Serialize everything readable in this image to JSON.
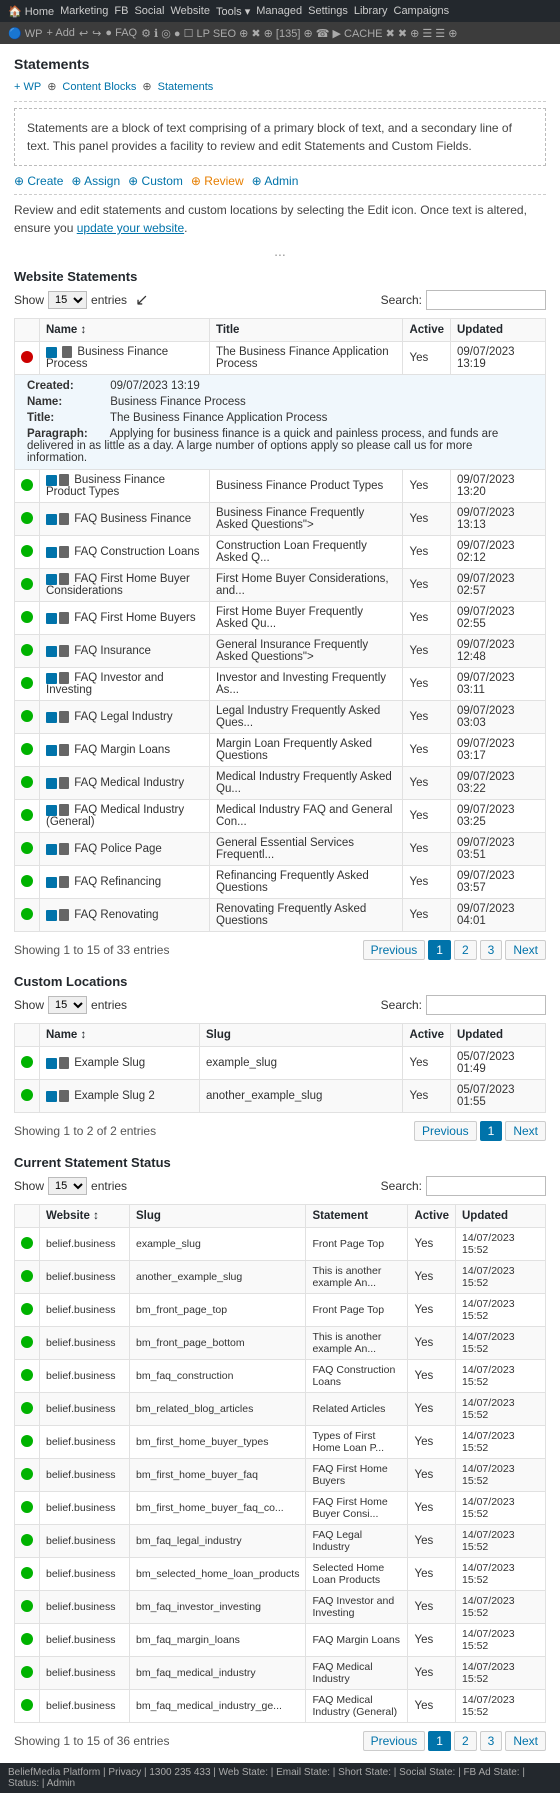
{
  "topbar": {
    "items": [
      "Home",
      "Marketing",
      "FB",
      "Social",
      "Website",
      "Tools",
      "Managed",
      "Settings",
      "Library",
      "Campaigns"
    ]
  },
  "secondbar": {
    "items": [
      "WP",
      "Add",
      "Undo",
      "Redo",
      "FAQ",
      "LP",
      "SEO",
      "135",
      "CACHE"
    ]
  },
  "statements_section": {
    "title": "Statements",
    "breadcrumbs": [
      "WP",
      "Content Blocks",
      "Statements"
    ],
    "description": "Statements are a block of text comprising of a primary block of text, and a secondary line of text. This panel provides a facility to review and edit Statements and Custom Fields.",
    "actions": [
      "Create",
      "Assign",
      "Custom",
      "Review",
      "Admin"
    ],
    "review_text": "Review and edit statements and custom locations by selecting the Edit icon. Once text is altered, ensure you",
    "review_link_text": "update your website",
    "ellipsis": "..."
  },
  "website_statements": {
    "title": "Website Statements",
    "show_label": "Show",
    "show_value": "15",
    "entries_label": "entries",
    "search_label": "Search:",
    "search_value": "",
    "columns": [
      "",
      "Name",
      "Title",
      "Active",
      "Updated"
    ],
    "expanded_row": {
      "created_label": "Created:",
      "created_value": "09/07/2023 13:19",
      "name_label": "Name:",
      "name_value": "Business Finance Process",
      "title_label": "Title:",
      "title_value": "The Business Finance Application Process",
      "paragraph_label": "Paragraph:",
      "paragraph_value": "Applying for business finance is a quick and painless process, and funds are delivered in as little as a day. A large number of options apply so please call us for more information."
    },
    "rows": [
      {
        "status": "red",
        "name": "Business Finance Process",
        "title": "The Business Finance Application Process",
        "active": "Yes",
        "updated": "09/07/2023 13:19",
        "expanded": true
      },
      {
        "status": "green",
        "name": "Business Finance Product Types",
        "title": "Business Finance Product Types",
        "active": "Yes",
        "updated": "09/07/2023 13:20"
      },
      {
        "status": "green",
        "name": "FAQ Business Finance",
        "title": "Business Finance Frequently Asked Questions\">",
        "active": "Yes",
        "updated": "09/07/2023 13:13"
      },
      {
        "status": "green",
        "name": "FAQ Construction Loans",
        "title": "Construction Loan Frequently Asked Q...",
        "active": "Yes",
        "updated": "09/07/2023 02:12"
      },
      {
        "status": "green",
        "name": "FAQ First Home Buyer Considerations",
        "title": "First Home Buyer Considerations, and...",
        "active": "Yes",
        "updated": "09/07/2023 02:57"
      },
      {
        "status": "green",
        "name": "FAQ First Home Buyers",
        "title": "First Home Buyer Frequently Asked Qu...",
        "active": "Yes",
        "updated": "09/07/2023 02:55"
      },
      {
        "status": "green",
        "name": "FAQ Insurance",
        "title": "General Insurance Frequently Asked Questions\">",
        "active": "Yes",
        "updated": "09/07/2023 12:48"
      },
      {
        "status": "green",
        "name": "FAQ Investor and Investing",
        "title": "Investor and Investing Frequently As...",
        "active": "Yes",
        "updated": "09/07/2023 03:11"
      },
      {
        "status": "green",
        "name": "FAQ Legal Industry",
        "title": "Legal Industry Frequently Asked Ques...",
        "active": "Yes",
        "updated": "09/07/2023 03:03"
      },
      {
        "status": "green",
        "name": "FAQ Margin Loans",
        "title": "Margin Loan Frequently Asked Questions",
        "active": "Yes",
        "updated": "09/07/2023 03:17"
      },
      {
        "status": "green",
        "name": "FAQ Medical Industry",
        "title": "Medical Industry Frequently Asked Qu...",
        "active": "Yes",
        "updated": "09/07/2023 03:22"
      },
      {
        "status": "green",
        "name": "FAQ Medical Industry (General)",
        "title": "Medical Industry FAQ and General Con...",
        "active": "Yes",
        "updated": "09/07/2023 03:25"
      },
      {
        "status": "green",
        "name": "FAQ Police Page",
        "title": "General Essential Services Frequentl...",
        "active": "Yes",
        "updated": "09/07/2023 03:51"
      },
      {
        "status": "green",
        "name": "FAQ Refinancing",
        "title": "Refinancing Frequently Asked Questions",
        "active": "Yes",
        "updated": "09/07/2023 03:57"
      },
      {
        "status": "green",
        "name": "FAQ Renovating",
        "title": "Renovating Frequently Asked Questions",
        "active": "Yes",
        "updated": "09/07/2023 04:01"
      }
    ],
    "showing": "Showing 1 to 15 of 33 entries",
    "pagination": {
      "prev": "Previous",
      "pages": [
        "1",
        "2",
        "3"
      ],
      "next": "Next",
      "active_page": "1"
    }
  },
  "custom_locations": {
    "title": "Custom Locations",
    "show_label": "Show",
    "show_value": "15",
    "entries_label": "entries",
    "search_label": "Search:",
    "search_value": "",
    "columns": [
      "",
      "Name",
      "Slug",
      "Active",
      "Updated"
    ],
    "rows": [
      {
        "status": "green",
        "name": "Example Slug",
        "slug": "example_slug",
        "active": "Yes",
        "updated": "05/07/2023 01:49"
      },
      {
        "status": "green",
        "name": "Example Slug 2",
        "slug": "another_example_slug",
        "active": "Yes",
        "updated": "05/07/2023 01:55"
      }
    ],
    "showing": "Showing 1 to 2 of 2 entries",
    "pagination": {
      "prev": "Previous",
      "pages": [
        "1"
      ],
      "next": "Next",
      "active_page": "1"
    }
  },
  "current_status": {
    "title": "Current Statement Status",
    "show_label": "Show",
    "show_value": "15",
    "entries_label": "entries",
    "search_label": "Search:",
    "search_value": "",
    "columns": [
      "",
      "Website",
      "Slug",
      "Statement",
      "Active",
      "Updated"
    ],
    "rows": [
      {
        "status": "green",
        "website": "belief.business",
        "slug": "example_slug",
        "statement": "Front Page Top",
        "active": "Yes",
        "updated": "14/07/2023 15:52"
      },
      {
        "status": "green",
        "website": "belief.business",
        "slug": "another_example_slug",
        "statement": "This is another example An...",
        "active": "Yes",
        "updated": "14/07/2023 15:52"
      },
      {
        "status": "green",
        "website": "belief.business",
        "slug": "bm_front_page_top",
        "statement": "Front Page Top",
        "active": "Yes",
        "updated": "14/07/2023 15:52"
      },
      {
        "status": "green",
        "website": "belief.business",
        "slug": "bm_front_page_bottom",
        "statement": "This is another example An...",
        "active": "Yes",
        "updated": "14/07/2023 15:52"
      },
      {
        "status": "green",
        "website": "belief.business",
        "slug": "bm_faq_construction",
        "statement": "FAQ Construction Loans",
        "active": "Yes",
        "updated": "14/07/2023 15:52"
      },
      {
        "status": "green",
        "website": "belief.business",
        "slug": "bm_related_blog_articles",
        "statement": "Related Articles",
        "active": "Yes",
        "updated": "14/07/2023 15:52"
      },
      {
        "status": "green",
        "website": "belief.business",
        "slug": "bm_first_home_buyer_types",
        "statement": "Types of First Home Loan P...",
        "active": "Yes",
        "updated": "14/07/2023 15:52"
      },
      {
        "status": "green",
        "website": "belief.business",
        "slug": "bm_first_home_buyer_faq",
        "statement": "FAQ First Home Buyers",
        "active": "Yes",
        "updated": "14/07/2023 15:52"
      },
      {
        "status": "green",
        "website": "belief.business",
        "slug": "bm_first_home_buyer_faq_co...",
        "statement": "FAQ First Home Buyer Consi...",
        "active": "Yes",
        "updated": "14/07/2023 15:52"
      },
      {
        "status": "green",
        "website": "belief.business",
        "slug": "bm_faq_legal_industry",
        "statement": "FAQ Legal Industry",
        "active": "Yes",
        "updated": "14/07/2023 15:52"
      },
      {
        "status": "green",
        "website": "belief.business",
        "slug": "bm_selected_home_loan_products",
        "statement": "Selected Home Loan Products",
        "active": "Yes",
        "updated": "14/07/2023 15:52"
      },
      {
        "status": "green",
        "website": "belief.business",
        "slug": "bm_faq_investor_investing",
        "statement": "FAQ Investor and Investing",
        "active": "Yes",
        "updated": "14/07/2023 15:52"
      },
      {
        "status": "green",
        "website": "belief.business",
        "slug": "bm_faq_margin_loans",
        "statement": "FAQ Margin Loans",
        "active": "Yes",
        "updated": "14/07/2023 15:52"
      },
      {
        "status": "green",
        "website": "belief.business",
        "slug": "bm_faq_medical_industry",
        "statement": "FAQ Medical Industry",
        "active": "Yes",
        "updated": "14/07/2023 15:52"
      },
      {
        "status": "green",
        "website": "belief.business",
        "slug": "bm_faq_medical_industry_ge...",
        "statement": "FAQ Medical Industry (General)",
        "active": "Yes",
        "updated": "14/07/2023 15:52"
      }
    ],
    "showing": "Showing 1 to 15 of 36 entries",
    "pagination": {
      "prev": "Previous",
      "pages": [
        "1",
        "2",
        "3"
      ],
      "next": "Next",
      "active_page": "1"
    }
  },
  "footer": {
    "text": "BeliefMedia Platform | Privacy | 1300 235 433 | Web State: | Email State: | Short State: | Social State: | FB Ad State: | Status: | Admin"
  }
}
